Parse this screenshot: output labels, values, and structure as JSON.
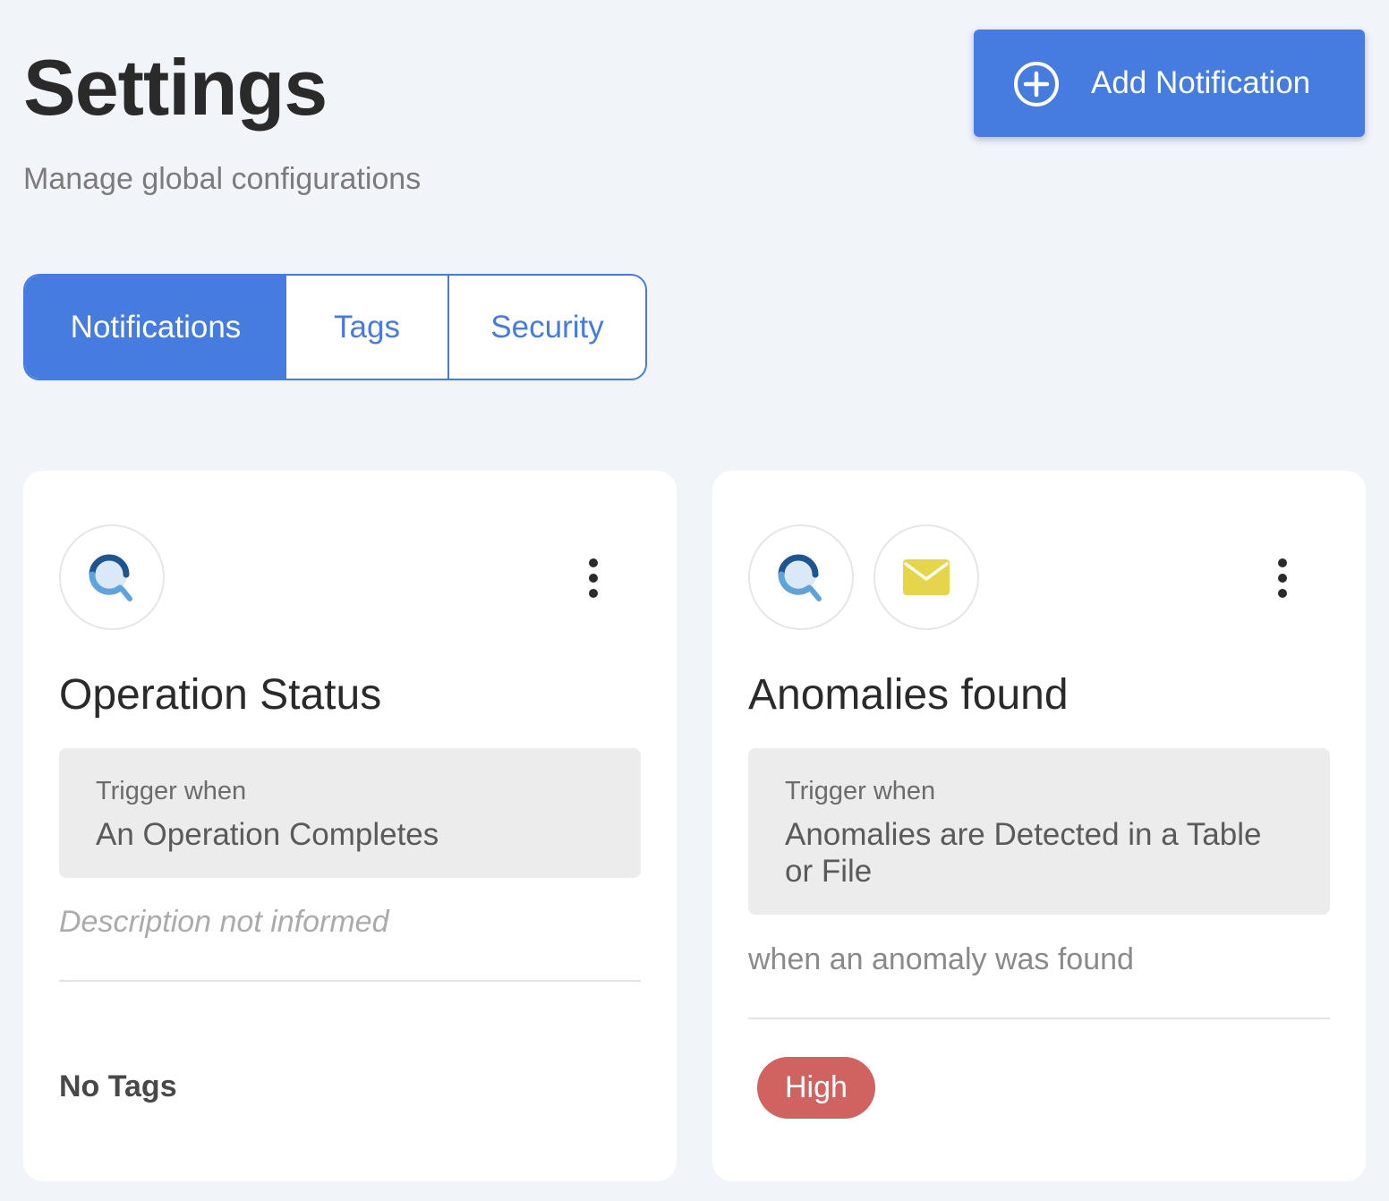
{
  "header": {
    "title": "Settings",
    "subtitle": "Manage global configurations",
    "add_button_label": "Add Notification",
    "add_button_icon": "plus-circle-icon"
  },
  "tabs": [
    {
      "label": "Notifications",
      "active": true
    },
    {
      "label": "Tags",
      "active": false
    },
    {
      "label": "Security",
      "active": false
    }
  ],
  "colors": {
    "accent": "#467bdf",
    "background": "#f1f4f9",
    "tag_high": "#d0625f",
    "mail_icon": "#e6d44a"
  },
  "cards": [
    {
      "channels": [
        "app-search-icon"
      ],
      "title": "Operation Status",
      "trigger_label": "Trigger when",
      "trigger_value": "An Operation Completes",
      "description": "Description not informed",
      "no_tags_label": "No Tags",
      "tags": []
    },
    {
      "channels": [
        "app-search-icon",
        "mail-icon"
      ],
      "title": "Anomalies found",
      "trigger_label": "Trigger when",
      "trigger_value": "Anomalies are Detected in a Table or File",
      "description": "when an anomaly was found",
      "tags": [
        "High"
      ]
    }
  ]
}
